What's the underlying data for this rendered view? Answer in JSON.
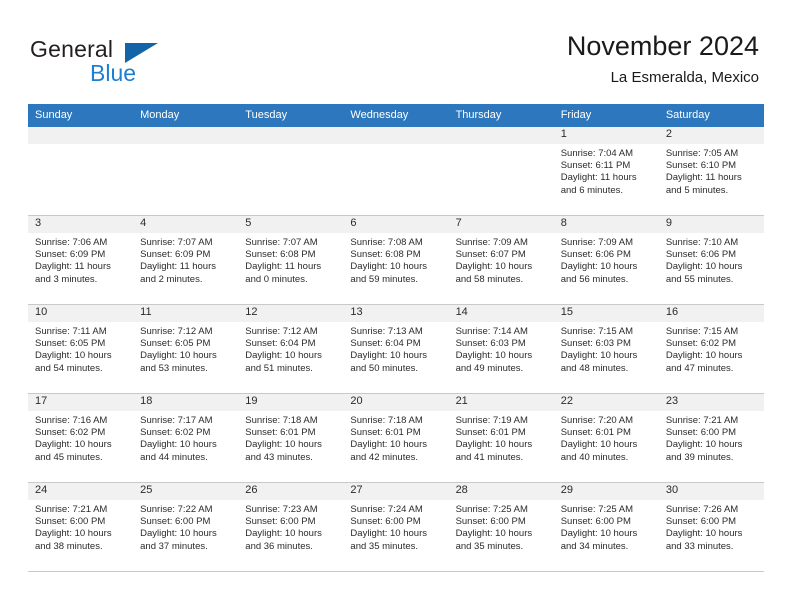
{
  "brand": {
    "word_general": "General",
    "word_blue": "Blue",
    "flag_color": "#1263a8",
    "blue_color": "#1b7fd4"
  },
  "header": {
    "title": "November 2024",
    "subtitle": "La Esmeralda, Mexico"
  },
  "theme": {
    "header_blue": "#2c77bd",
    "daynum_gray": "#f1f1f1",
    "grid_gray": "#c9c9c9"
  },
  "calendar": {
    "weekday_headers": [
      "Sunday",
      "Monday",
      "Tuesday",
      "Wednesday",
      "Thursday",
      "Friday",
      "Saturday"
    ],
    "labels": {
      "sunrise_prefix": "Sunrise:",
      "sunset_prefix": "Sunset:",
      "daylight_prefix": "Daylight:"
    },
    "weeks": [
      [
        {
          "day": "",
          "sunrise": "",
          "sunset": "",
          "daylight": ""
        },
        {
          "day": "",
          "sunrise": "",
          "sunset": "",
          "daylight": ""
        },
        {
          "day": "",
          "sunrise": "",
          "sunset": "",
          "daylight": ""
        },
        {
          "day": "",
          "sunrise": "",
          "sunset": "",
          "daylight": ""
        },
        {
          "day": "",
          "sunrise": "",
          "sunset": "",
          "daylight": ""
        },
        {
          "day": "1",
          "sunrise": "Sunrise: 7:04 AM",
          "sunset": "Sunset: 6:11 PM",
          "daylight": "Daylight: 11 hours and 6 minutes."
        },
        {
          "day": "2",
          "sunrise": "Sunrise: 7:05 AM",
          "sunset": "Sunset: 6:10 PM",
          "daylight": "Daylight: 11 hours and 5 minutes."
        }
      ],
      [
        {
          "day": "3",
          "sunrise": "Sunrise: 7:06 AM",
          "sunset": "Sunset: 6:09 PM",
          "daylight": "Daylight: 11 hours and 3 minutes."
        },
        {
          "day": "4",
          "sunrise": "Sunrise: 7:07 AM",
          "sunset": "Sunset: 6:09 PM",
          "daylight": "Daylight: 11 hours and 2 minutes."
        },
        {
          "day": "5",
          "sunrise": "Sunrise: 7:07 AM",
          "sunset": "Sunset: 6:08 PM",
          "daylight": "Daylight: 11 hours and 0 minutes."
        },
        {
          "day": "6",
          "sunrise": "Sunrise: 7:08 AM",
          "sunset": "Sunset: 6:08 PM",
          "daylight": "Daylight: 10 hours and 59 minutes."
        },
        {
          "day": "7",
          "sunrise": "Sunrise: 7:09 AM",
          "sunset": "Sunset: 6:07 PM",
          "daylight": "Daylight: 10 hours and 58 minutes."
        },
        {
          "day": "8",
          "sunrise": "Sunrise: 7:09 AM",
          "sunset": "Sunset: 6:06 PM",
          "daylight": "Daylight: 10 hours and 56 minutes."
        },
        {
          "day": "9",
          "sunrise": "Sunrise: 7:10 AM",
          "sunset": "Sunset: 6:06 PM",
          "daylight": "Daylight: 10 hours and 55 minutes."
        }
      ],
      [
        {
          "day": "10",
          "sunrise": "Sunrise: 7:11 AM",
          "sunset": "Sunset: 6:05 PM",
          "daylight": "Daylight: 10 hours and 54 minutes."
        },
        {
          "day": "11",
          "sunrise": "Sunrise: 7:12 AM",
          "sunset": "Sunset: 6:05 PM",
          "daylight": "Daylight: 10 hours and 53 minutes."
        },
        {
          "day": "12",
          "sunrise": "Sunrise: 7:12 AM",
          "sunset": "Sunset: 6:04 PM",
          "daylight": "Daylight: 10 hours and 51 minutes."
        },
        {
          "day": "13",
          "sunrise": "Sunrise: 7:13 AM",
          "sunset": "Sunset: 6:04 PM",
          "daylight": "Daylight: 10 hours and 50 minutes."
        },
        {
          "day": "14",
          "sunrise": "Sunrise: 7:14 AM",
          "sunset": "Sunset: 6:03 PM",
          "daylight": "Daylight: 10 hours and 49 minutes."
        },
        {
          "day": "15",
          "sunrise": "Sunrise: 7:15 AM",
          "sunset": "Sunset: 6:03 PM",
          "daylight": "Daylight: 10 hours and 48 minutes."
        },
        {
          "day": "16",
          "sunrise": "Sunrise: 7:15 AM",
          "sunset": "Sunset: 6:02 PM",
          "daylight": "Daylight: 10 hours and 47 minutes."
        }
      ],
      [
        {
          "day": "17",
          "sunrise": "Sunrise: 7:16 AM",
          "sunset": "Sunset: 6:02 PM",
          "daylight": "Daylight: 10 hours and 45 minutes."
        },
        {
          "day": "18",
          "sunrise": "Sunrise: 7:17 AM",
          "sunset": "Sunset: 6:02 PM",
          "daylight": "Daylight: 10 hours and 44 minutes."
        },
        {
          "day": "19",
          "sunrise": "Sunrise: 7:18 AM",
          "sunset": "Sunset: 6:01 PM",
          "daylight": "Daylight: 10 hours and 43 minutes."
        },
        {
          "day": "20",
          "sunrise": "Sunrise: 7:18 AM",
          "sunset": "Sunset: 6:01 PM",
          "daylight": "Daylight: 10 hours and 42 minutes."
        },
        {
          "day": "21",
          "sunrise": "Sunrise: 7:19 AM",
          "sunset": "Sunset: 6:01 PM",
          "daylight": "Daylight: 10 hours and 41 minutes."
        },
        {
          "day": "22",
          "sunrise": "Sunrise: 7:20 AM",
          "sunset": "Sunset: 6:01 PM",
          "daylight": "Daylight: 10 hours and 40 minutes."
        },
        {
          "day": "23",
          "sunrise": "Sunrise: 7:21 AM",
          "sunset": "Sunset: 6:00 PM",
          "daylight": "Daylight: 10 hours and 39 minutes."
        }
      ],
      [
        {
          "day": "24",
          "sunrise": "Sunrise: 7:21 AM",
          "sunset": "Sunset: 6:00 PM",
          "daylight": "Daylight: 10 hours and 38 minutes."
        },
        {
          "day": "25",
          "sunrise": "Sunrise: 7:22 AM",
          "sunset": "Sunset: 6:00 PM",
          "daylight": "Daylight: 10 hours and 37 minutes."
        },
        {
          "day": "26",
          "sunrise": "Sunrise: 7:23 AM",
          "sunset": "Sunset: 6:00 PM",
          "daylight": "Daylight: 10 hours and 36 minutes."
        },
        {
          "day": "27",
          "sunrise": "Sunrise: 7:24 AM",
          "sunset": "Sunset: 6:00 PM",
          "daylight": "Daylight: 10 hours and 35 minutes."
        },
        {
          "day": "28",
          "sunrise": "Sunrise: 7:25 AM",
          "sunset": "Sunset: 6:00 PM",
          "daylight": "Daylight: 10 hours and 35 minutes."
        },
        {
          "day": "29",
          "sunrise": "Sunrise: 7:25 AM",
          "sunset": "Sunset: 6:00 PM",
          "daylight": "Daylight: 10 hours and 34 minutes."
        },
        {
          "day": "30",
          "sunrise": "Sunrise: 7:26 AM",
          "sunset": "Sunset: 6:00 PM",
          "daylight": "Daylight: 10 hours and 33 minutes."
        }
      ]
    ]
  }
}
